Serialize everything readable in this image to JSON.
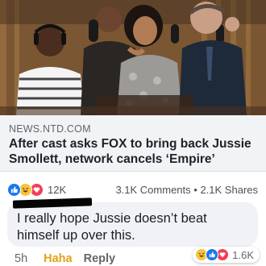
{
  "post": {
    "link": {
      "domain": "NEWS.NTD.COM",
      "headline": "After cast asks FOX to bring back Jussie Smollett, network cancels ‘Empire’"
    },
    "stats": {
      "reaction_count": "12K",
      "comments": "3.1K Comments",
      "separator": "•",
      "shares": "2.1K Shares",
      "reaction_icons": [
        "like-icon",
        "haha-icon",
        "love-icon"
      ]
    }
  },
  "comment": {
    "text": "I really hope Jussie doesn’t beat himself up over this.",
    "time": "5h",
    "haha_label": "Haha",
    "reply_label": "Reply",
    "reaction_count": "1.6K",
    "reaction_icons": [
      "haha-icon",
      "like-icon",
      "love-icon"
    ]
  },
  "colors": {
    "like": "#1877f2",
    "haha": "#f7c43c",
    "love": "#f33e58",
    "haha_text": "#e0a314"
  }
}
